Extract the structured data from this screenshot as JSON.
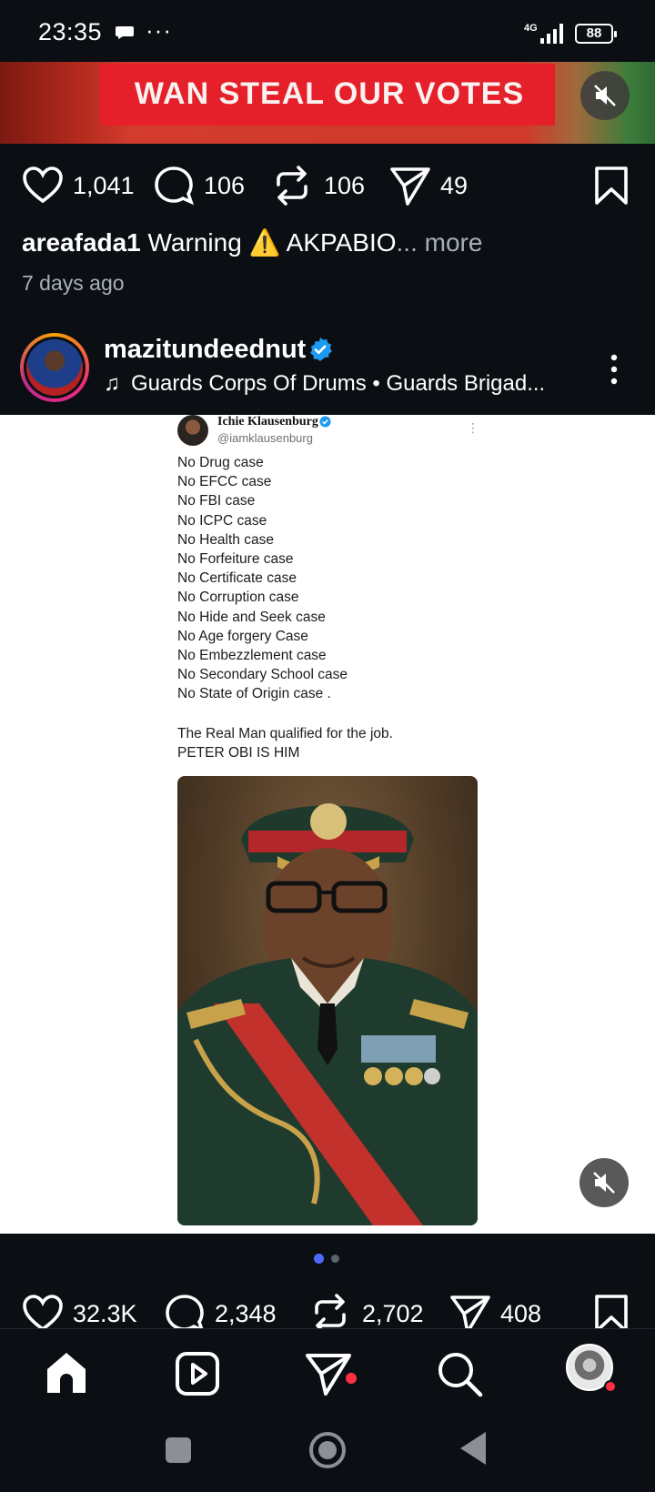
{
  "status_bar": {
    "time": "23:35",
    "dots": "···",
    "network": "4G",
    "battery": "88"
  },
  "top_post": {
    "banner_text": "WAN STEAL OUR VOTES",
    "likes": "1,041",
    "comments": "106",
    "reposts": "106",
    "shares": "49",
    "caption_user": "areafada1",
    "caption_text": " Warning ⚠️ AKPABIO",
    "caption_more": "... more",
    "time_ago": "7 days ago"
  },
  "post": {
    "username": "mazitundeednut",
    "music": "Guards Corps Of Drums • Guards Brigad...",
    "tweet": {
      "name": "Ichie Klausenburg",
      "handle": "@iamklausenburg",
      "menu": "⋮",
      "lines": [
        "No Drug case",
        "No EFCC case",
        "No FBI case",
        "No ICPC case",
        "No Health case",
        "No Forfeiture case",
        "No Certificate case",
        "No Corruption case",
        "No Hide and Seek case",
        "No Age forgery Case",
        "No Embezzlement case",
        "No Secondary School case",
        "No State of Origin case ."
      ],
      "footer_1": "The Real Man qualified for the job.",
      "footer_2": "PETER OBI IS HIM"
    },
    "carousel": {
      "active_index": 0,
      "count": 2,
      "active_color": "#4f6bff",
      "inactive_color": "#5a6270"
    },
    "likes": "32.3K",
    "comments": "2,348",
    "reposts": "2,702",
    "shares": "408"
  },
  "icons": {
    "like": "heart-icon",
    "comment": "comment-icon",
    "repost": "repost-icon",
    "share": "send-icon",
    "save": "bookmark-icon",
    "mute": "speaker-muted-icon",
    "home": "home-icon",
    "reels": "reels-icon",
    "messages": "paper-plane-icon",
    "search": "search-icon"
  },
  "colors": {
    "background": "#0b0f14",
    "verified": "#1d9bf0",
    "notification": "#ff3040"
  }
}
